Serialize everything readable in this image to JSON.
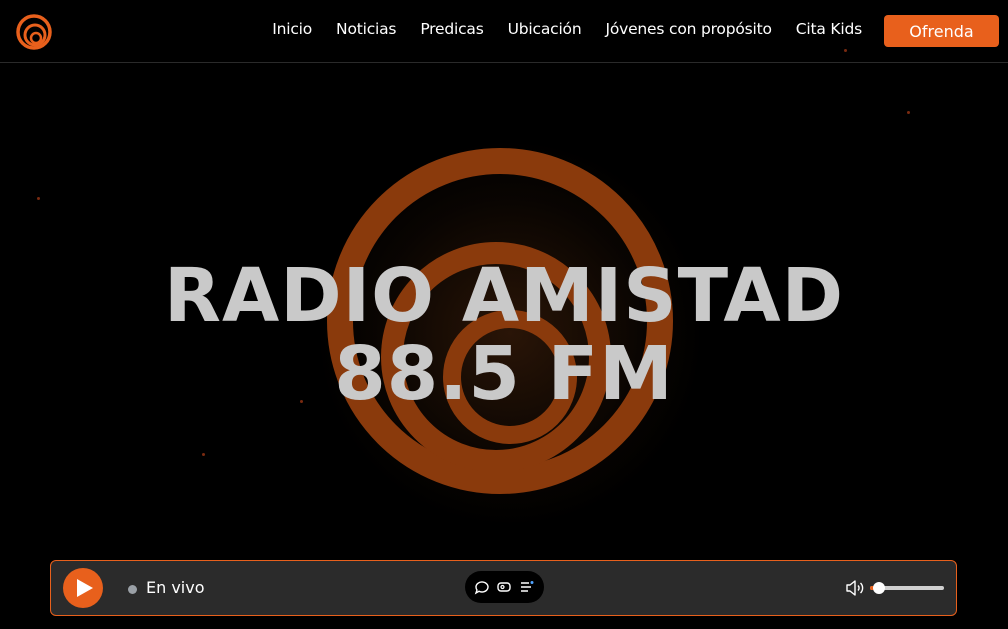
{
  "nav": {
    "items": [
      "Inicio",
      "Noticias",
      "Predicas",
      "Ubicación",
      "Jóvenes con propósito",
      "Cita Kids"
    ],
    "cta": "Ofrenda"
  },
  "hero": {
    "line1": "RADIO AMISTAD",
    "line2": "88.5 FM"
  },
  "player": {
    "status": "En vivo",
    "volume_fraction": 0.12
  },
  "colors": {
    "accent": "#e8601c",
    "background": "#000000",
    "player_bg": "#2b2b2b"
  },
  "icons": [
    "logo-icon",
    "play-icon",
    "chat-icon",
    "cast-icon",
    "playlist-icon",
    "volume-icon"
  ]
}
